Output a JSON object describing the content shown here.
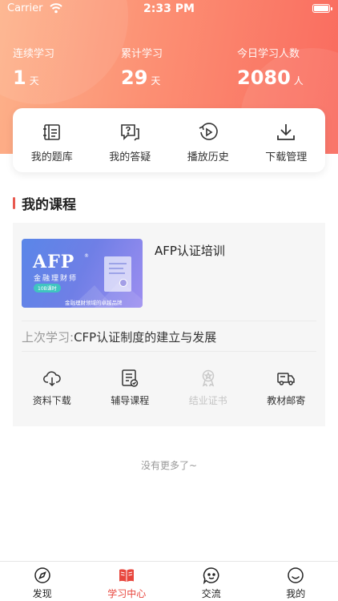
{
  "status_bar": {
    "carrier": "Carrier",
    "time": "2:33 PM"
  },
  "stats": [
    {
      "label": "连续学习",
      "value": "1",
      "unit": "天"
    },
    {
      "label": "累计学习",
      "value": "29",
      "unit": "天"
    },
    {
      "label": "今日学习人数",
      "value": "2080",
      "unit": "人"
    }
  ],
  "quick_menu": [
    {
      "label": "我的题库",
      "icon": "question-bank-icon"
    },
    {
      "label": "我的答疑",
      "icon": "qa-icon"
    },
    {
      "label": "播放历史",
      "icon": "play-history-icon"
    },
    {
      "label": "下载管理",
      "icon": "download-icon"
    }
  ],
  "section_title": "我的课程",
  "course": {
    "title": "AFP认证培训",
    "cover": {
      "logo": "AFP",
      "reg": "®",
      "subtitle": "金融理财师",
      "pill": "10B课时",
      "brand_line": "金融理财领域的卓越品牌"
    },
    "last_study_label": "上次学习:",
    "last_study_value": "CFP认证制度的建立与发展",
    "actions": [
      {
        "label": "资料下载",
        "icon": "cloud-download-icon",
        "enabled": true
      },
      {
        "label": "辅导课程",
        "icon": "tutoring-icon",
        "enabled": true
      },
      {
        "label": "结业证书",
        "icon": "certificate-icon",
        "enabled": false
      },
      {
        "label": "教材邮寄",
        "icon": "truck-icon",
        "enabled": true
      }
    ]
  },
  "footer_text": "没有更多了~",
  "tabs": [
    {
      "label": "发现",
      "icon": "compass-icon",
      "active": false
    },
    {
      "label": "学习中心",
      "icon": "book-icon",
      "active": true
    },
    {
      "label": "交流",
      "icon": "chat-icon",
      "active": false
    },
    {
      "label": "我的",
      "icon": "smile-icon",
      "active": false
    }
  ],
  "colors": {
    "accent": "#e8463d",
    "hero_start": "#fdb28a",
    "hero_end": "#f96a5e",
    "card_bg": "#f6f6f6"
  }
}
